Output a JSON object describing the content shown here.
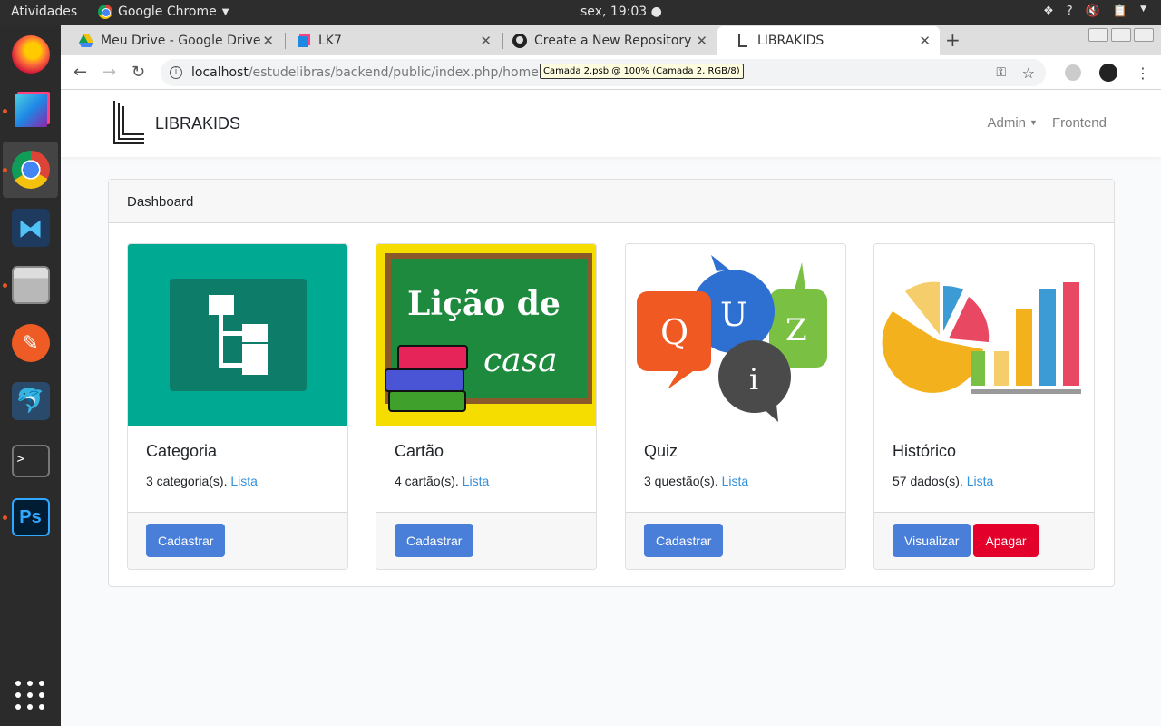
{
  "system": {
    "activities": "Atividades",
    "app_menu": "Google Chrome",
    "clock": "sex, 19:03"
  },
  "dock": {
    "items": [
      "firefox-icon",
      "layers-app-icon",
      "chrome-icon",
      "vscode-icon",
      "files-icon",
      "postman-icon",
      "mysql-workbench-icon",
      "terminal-icon",
      "photoshop-icon"
    ]
  },
  "browser": {
    "tabs": [
      {
        "title": "Meu Drive - Google Drive"
      },
      {
        "title": "LK7"
      },
      {
        "title": "Create a New Repository"
      },
      {
        "title": "LIBRAKIDS"
      }
    ],
    "url_host": "localhost",
    "url_path": "/estudelibras/backend/public/index.php/home",
    "tooltip": "Camada 2.psb @ 100% (Camada 2, RGB/8)"
  },
  "app": {
    "brand": "LIBRAKIDS",
    "nav": {
      "admin": "Admin",
      "frontend": "Frontend"
    },
    "dashboard_title": "Dashboard",
    "cards": [
      {
        "title": "Categoria",
        "text": "3 categoria(s).",
        "link": "Lista",
        "buttons": [
          "Cadastrar"
        ]
      },
      {
        "title": "Cartão",
        "text": "4 cartão(s).",
        "link": "Lista",
        "buttons": [
          "Cadastrar"
        ]
      },
      {
        "title": "Quiz",
        "text": "3 questão(s).",
        "link": "Lista",
        "buttons": [
          "Cadastrar"
        ]
      },
      {
        "title": "Histórico",
        "text": "57 dados(s).",
        "link": "Lista",
        "buttons": [
          "Visualizar",
          "Apagar"
        ]
      }
    ],
    "images": {
      "licao_line1": "Lição de",
      "licao_line2": "casa",
      "quiz_letters": [
        "Q",
        "U",
        "Z",
        "i"
      ]
    }
  }
}
